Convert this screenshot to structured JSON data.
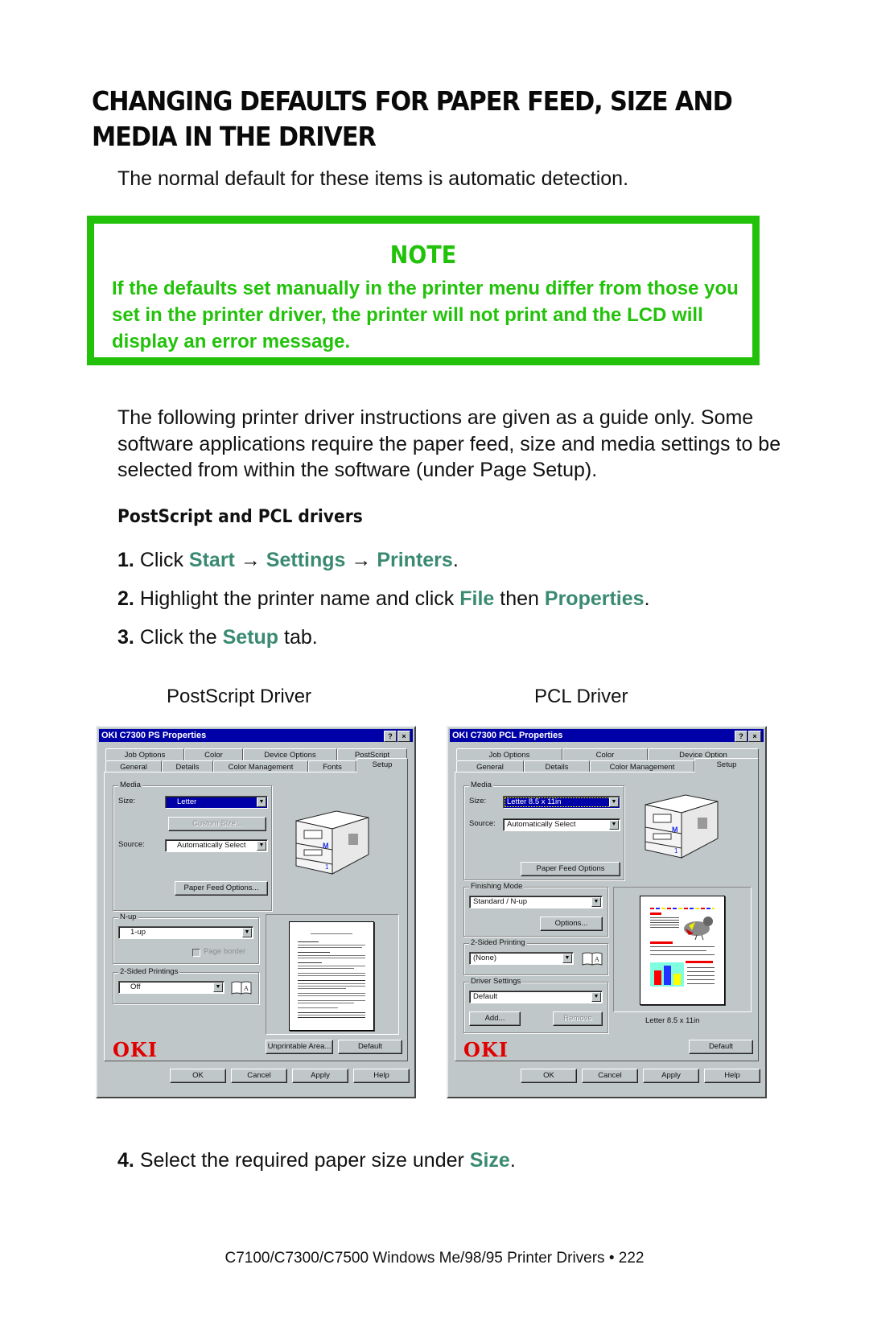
{
  "heading": "CHANGING DEFAULTS FOR PAPER FEED, SIZE AND MEDIA IN THE DRIVER",
  "intro": "The normal default for these items is automatic detection.",
  "note": {
    "title": "NOTE",
    "text": "If the defaults set manually in the printer menu differ from those you set in the printer driver, the printer will not print and the LCD will display an error message.",
    "accent_color": "#22c20a"
  },
  "paragraph": "The following printer driver instructions are given as a guide only. Some software applications require the paper feed, size and media settings to be selected from within the software (under Page Setup).",
  "subheading": "PostScript and PCL drivers",
  "keyword_color": "#3a8a72",
  "steps": [
    {
      "num": "1.",
      "parts": [
        "Click ",
        "Start",
        " → ",
        "Settings",
        " → ",
        "Printers",
        "."
      ]
    },
    {
      "num": "2.",
      "parts": [
        "Highlight the printer name and click ",
        "File",
        " then ",
        "Properties",
        "."
      ]
    },
    {
      "num": "3.",
      "parts": [
        "Click the ",
        "Setup",
        " tab."
      ]
    },
    {
      "num": "4.",
      "parts": [
        "Select the required paper size under ",
        "Size",
        "."
      ]
    }
  ],
  "captions": {
    "ps": "PostScript Driver",
    "pcl": "PCL Driver"
  },
  "ps_dialog": {
    "title": "OKI C7300 PS Properties",
    "help_btn": "?",
    "close_btn": "×",
    "tabs_back": [
      "Job Options",
      "Color",
      "Device Options",
      "PostScript"
    ],
    "tabs_front": [
      "General",
      "Details",
      "Color Management",
      "Fonts",
      "Setup"
    ],
    "media_group": "Media",
    "size_label": "Size:",
    "size_value": "Letter",
    "custom_size_btn": "Custom Size...",
    "source_label": "Source:",
    "source_value": "Automatically Select",
    "paper_feed_btn": "Paper Feed Options...",
    "nup_group": "N-up",
    "nup_value": "1-up",
    "page_border_label": "Page border",
    "duplex_group": "2-Sided Printings",
    "duplex_value": "Off",
    "printer_badge_m": "M",
    "printer_badge_1": "1",
    "logo": "OKI",
    "unprintable_btn": "Unprintable Area...",
    "default_btn": "Default",
    "ok_btn": "OK",
    "cancel_btn": "Cancel",
    "apply_btn": "Apply",
    "help_text_btn": "Help"
  },
  "pcl_dialog": {
    "title": "OKI C7300 PCL Properties",
    "help_btn": "?",
    "close_btn": "×",
    "tabs_back": [
      "Job Options",
      "Color",
      "Device Option"
    ],
    "tabs_front": [
      "General",
      "Details",
      "Color Management",
      "Setup"
    ],
    "media_group": "Media",
    "size_label": "Size:",
    "size_value": "Letter 8.5 x 11in",
    "source_label": "Source:",
    "source_value": "Automatically Select",
    "paper_feed_btn": "Paper Feed Options",
    "finishing_group": "Finishing Mode",
    "finishing_value": "Standard / N-up",
    "options_btn": "Options...",
    "duplex_group": "2-Sided Printing",
    "duplex_value": "(None)",
    "driver_settings_group": "Driver Settings",
    "driver_settings_value": "Default",
    "add_btn": "Add...",
    "remove_btn": "Remove",
    "preview_caption": "Letter 8.5 x 11in",
    "printer_badge_m": "M",
    "printer_badge_1": "1",
    "logo": "OKI",
    "default_btn": "Default",
    "ok_btn": "OK",
    "cancel_btn": "Cancel",
    "apply_btn": "Apply",
    "help_text_btn": "Help"
  },
  "footer": "C7100/C7300/C7500 Windows Me/98/95 Printer Drivers • 222"
}
